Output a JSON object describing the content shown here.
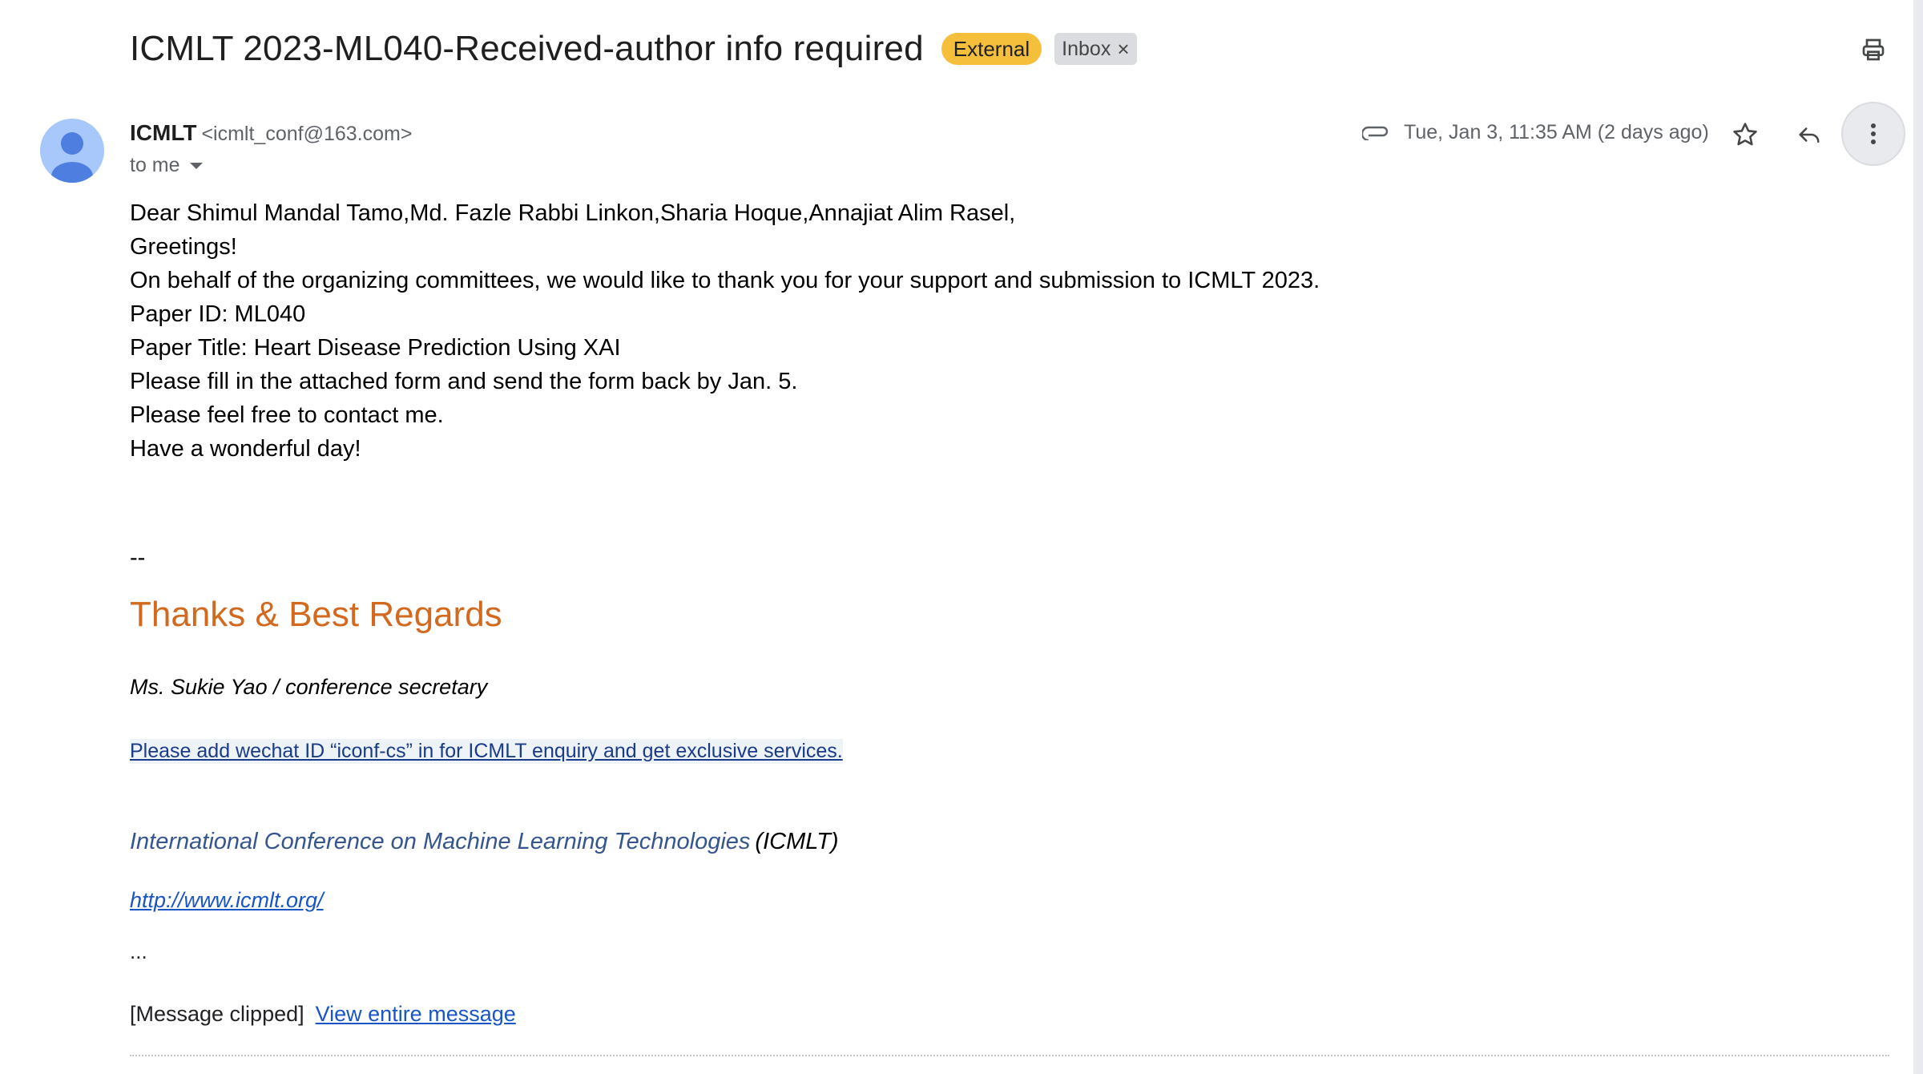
{
  "email": {
    "subject": "ICMLT 2023-ML040-Received-author info required",
    "labels": {
      "external": "External",
      "inbox": "Inbox",
      "inbox_remove": "×"
    },
    "sender": {
      "name": "ICMLT",
      "email": "<icmlt_conf@163.com>"
    },
    "recipient_label": "to me",
    "date": "Tue, Jan 3, 11:35 AM (2 days ago)",
    "body_lines": [
      "Dear Shimul Mandal Tamo,Md. Fazle Rabbi Linkon,Sharia Hoque,Annajiat Alim Rasel,",
      "Greetings!",
      "On behalf of the organizing committees, we would like to thank you for your support and submission to ICMLT 2023.",
      "Paper ID: ML040",
      "Paper Title: Heart Disease Prediction Using XAI",
      "Please fill in the attached form and send the form back by Jan. 5.",
      "Please feel free to contact me.",
      "Have a wonderful day!"
    ],
    "signature": {
      "separator": "--",
      "regards": "Thanks & Best Regards",
      "secretary": "Ms. Sukie Yao  / conference secretary",
      "wechat_link": "Please add wechat ID “iconf-cs” in for ICMLT enquiry and get exclusive services.",
      "conference_name": "International Conference on Machine Learning Technologies",
      "conference_abbr": "(ICMLT)",
      "website": "http://www.icmlt.org/",
      "ellipsis": "..."
    },
    "clipped_text": "[Message clipped]",
    "view_entire": "View entire message"
  },
  "colors": {
    "external_badge": "#f6bf3b",
    "inbox_badge": "#dadce0",
    "regards": "#d2691e",
    "link": "#1a55c5",
    "conference_name": "#35558f"
  },
  "icons": [
    "print-icon",
    "avatar-icon",
    "attachment-icon",
    "star-icon",
    "reply-icon",
    "more-vert-icon",
    "caret-down-icon",
    "close-icon"
  ]
}
